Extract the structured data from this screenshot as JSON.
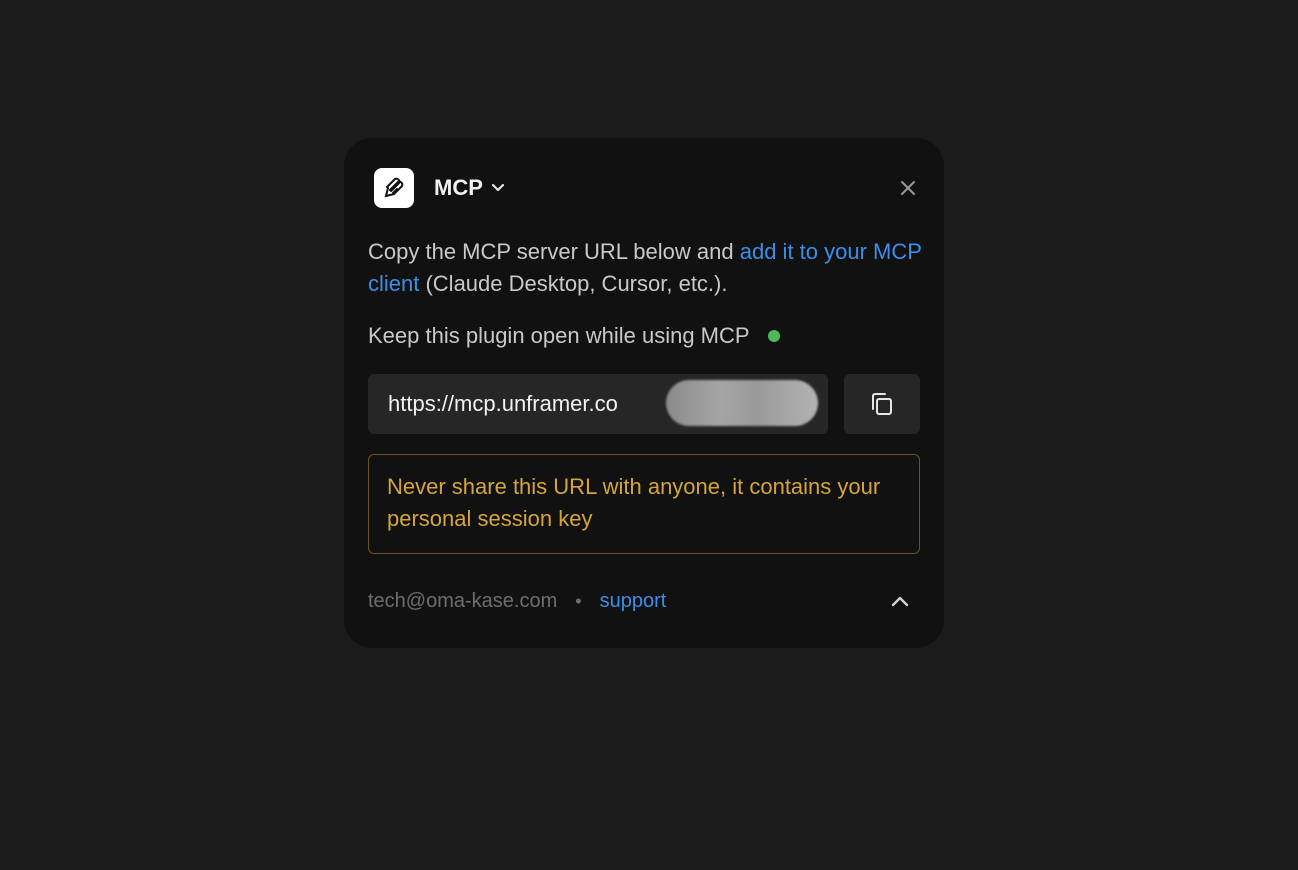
{
  "plugin": {
    "title": "MCP",
    "logo_icon": "framer-logo-icon"
  },
  "description": {
    "text_before": "Copy the MCP server URL below and ",
    "link_text": "add it to your MCP client",
    "text_after": " (Claude Desktop, Cursor, etc.)."
  },
  "status": {
    "text": "Keep this plugin open while using MCP",
    "color": "#4cbb5c"
  },
  "url_field": {
    "value": "https://mcp.unframer.co"
  },
  "warning": {
    "text": "Never share this URL with anyone, it contains your personal session key",
    "color": "#d6a53a"
  },
  "footer": {
    "email": "tech@oma-kase.com",
    "separator": "•",
    "support_label": "support"
  },
  "colors": {
    "link": "#3b8fe8",
    "background": "#1b1b1b",
    "panel": "#111111"
  }
}
